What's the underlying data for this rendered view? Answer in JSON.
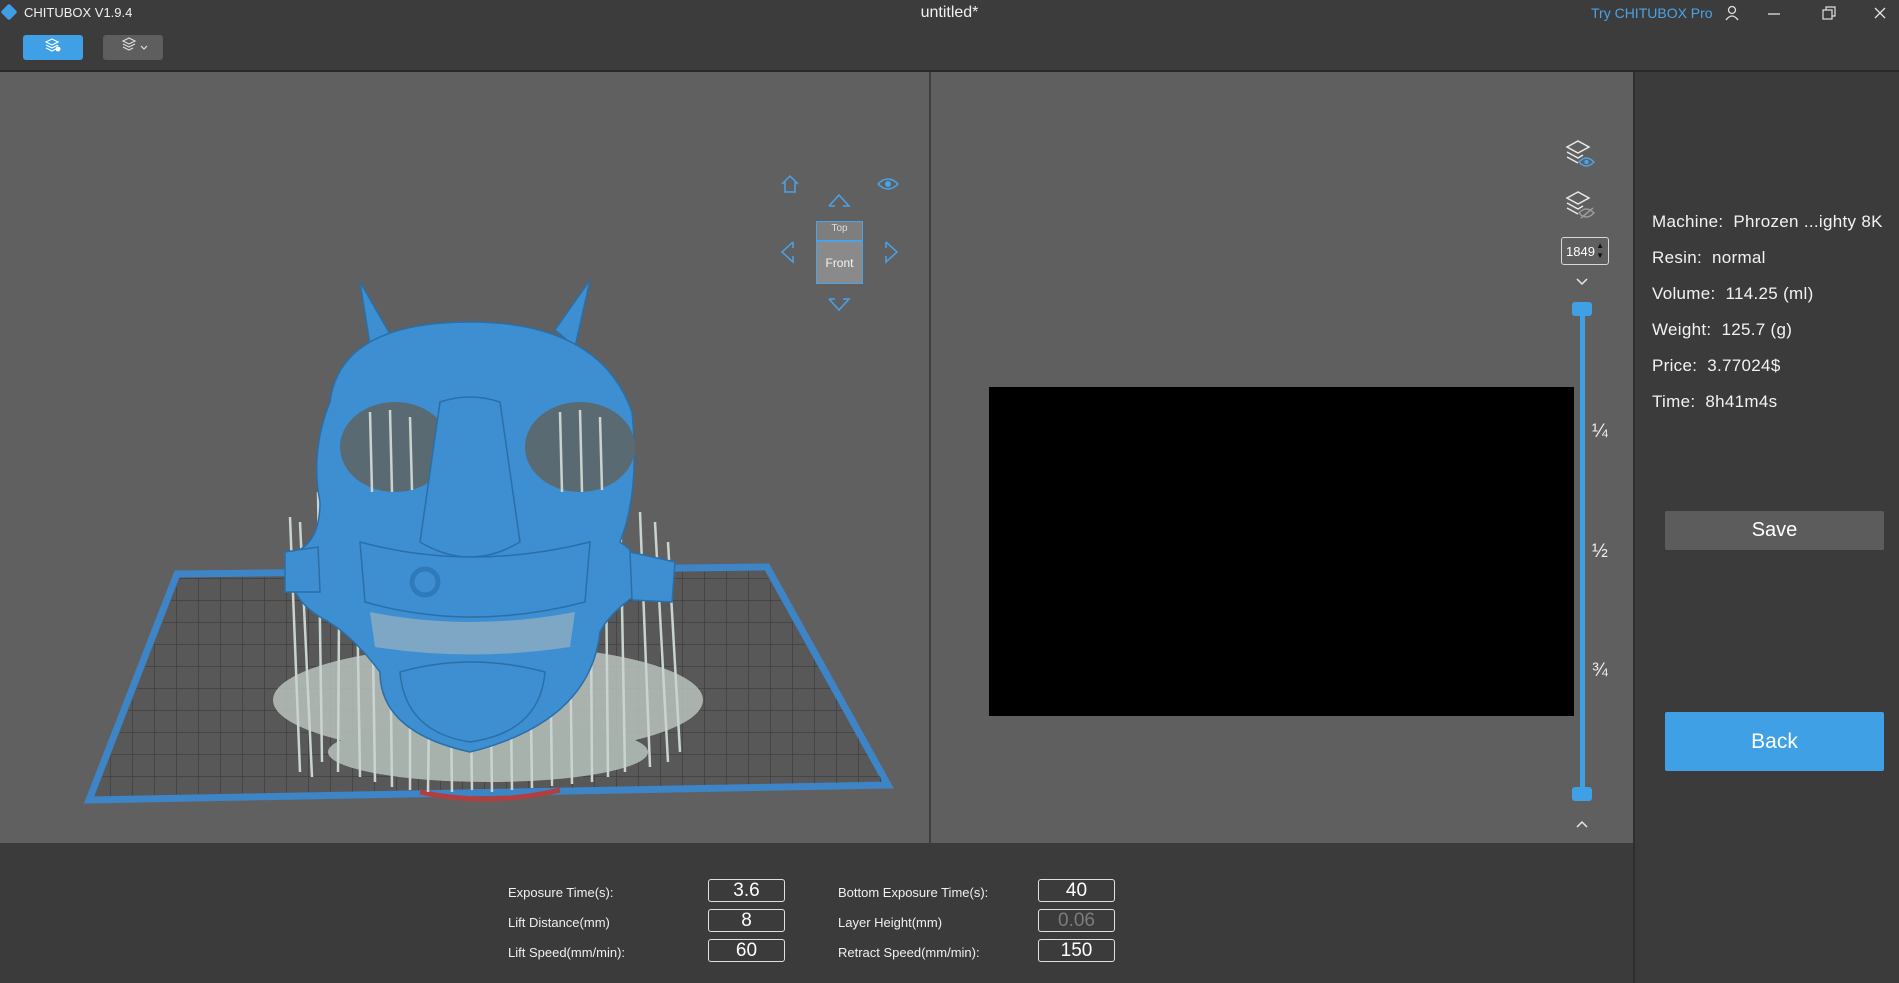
{
  "app": {
    "name": "CHITUBOX V1.9.4",
    "document_title": "untitled*",
    "try_pro": "Try CHITUBOX Pro"
  },
  "colors": {
    "accent": "#3fa0e6",
    "model": "#3d8fd1",
    "plate_border": "#3d85c6",
    "background": "#606060"
  },
  "view_cube": {
    "top_label": "Top",
    "front_label": "Front"
  },
  "slice_preview": {
    "layer": "1849"
  },
  "slider_marks": [
    "¼",
    "½",
    "¾"
  ],
  "info": {
    "machine_label": "Machine:",
    "machine_value": "Phrozen ...ighty 8K",
    "resin_label": "Resin:",
    "resin_value": "normal",
    "volume_label": "Volume:",
    "volume_value": "114.25  (ml)",
    "weight_label": "Weight:",
    "weight_value": "125.7  (g)",
    "price_label": "Price:",
    "price_value": "3.77024$",
    "time_label": "Time:",
    "time_value": "8h41m4s"
  },
  "buttons": {
    "save": "Save",
    "back": "Back"
  },
  "params": {
    "exposure_time_label": "Exposure Time(s):",
    "exposure_time_value": "3.6",
    "lift_distance_label": "Lift Distance(mm)",
    "lift_distance_value": "8",
    "lift_speed_label": "Lift Speed(mm/min):",
    "lift_speed_value": "60",
    "bottom_exposure_label": "Bottom Exposure Time(s):",
    "bottom_exposure_value": "40",
    "layer_height_label": "Layer Height(mm)",
    "layer_height_value": "0.06",
    "retract_speed_label": "Retract Speed(mm/min):",
    "retract_speed_value": "150"
  },
  "icons": {
    "app_logo": "chitubox-logo-icon",
    "user": "user-icon",
    "minimize": "minimize-icon",
    "restore": "restore-icon",
    "close": "close-icon",
    "slice_toolbar": "layers-settings-icon",
    "layer_menu": "layers-dropdown-icon",
    "home_view": "home-icon",
    "visibility": "eye-icon",
    "layers_visible": "layers-eye-icon",
    "layers_hidden": "layers-hidden-icon"
  }
}
